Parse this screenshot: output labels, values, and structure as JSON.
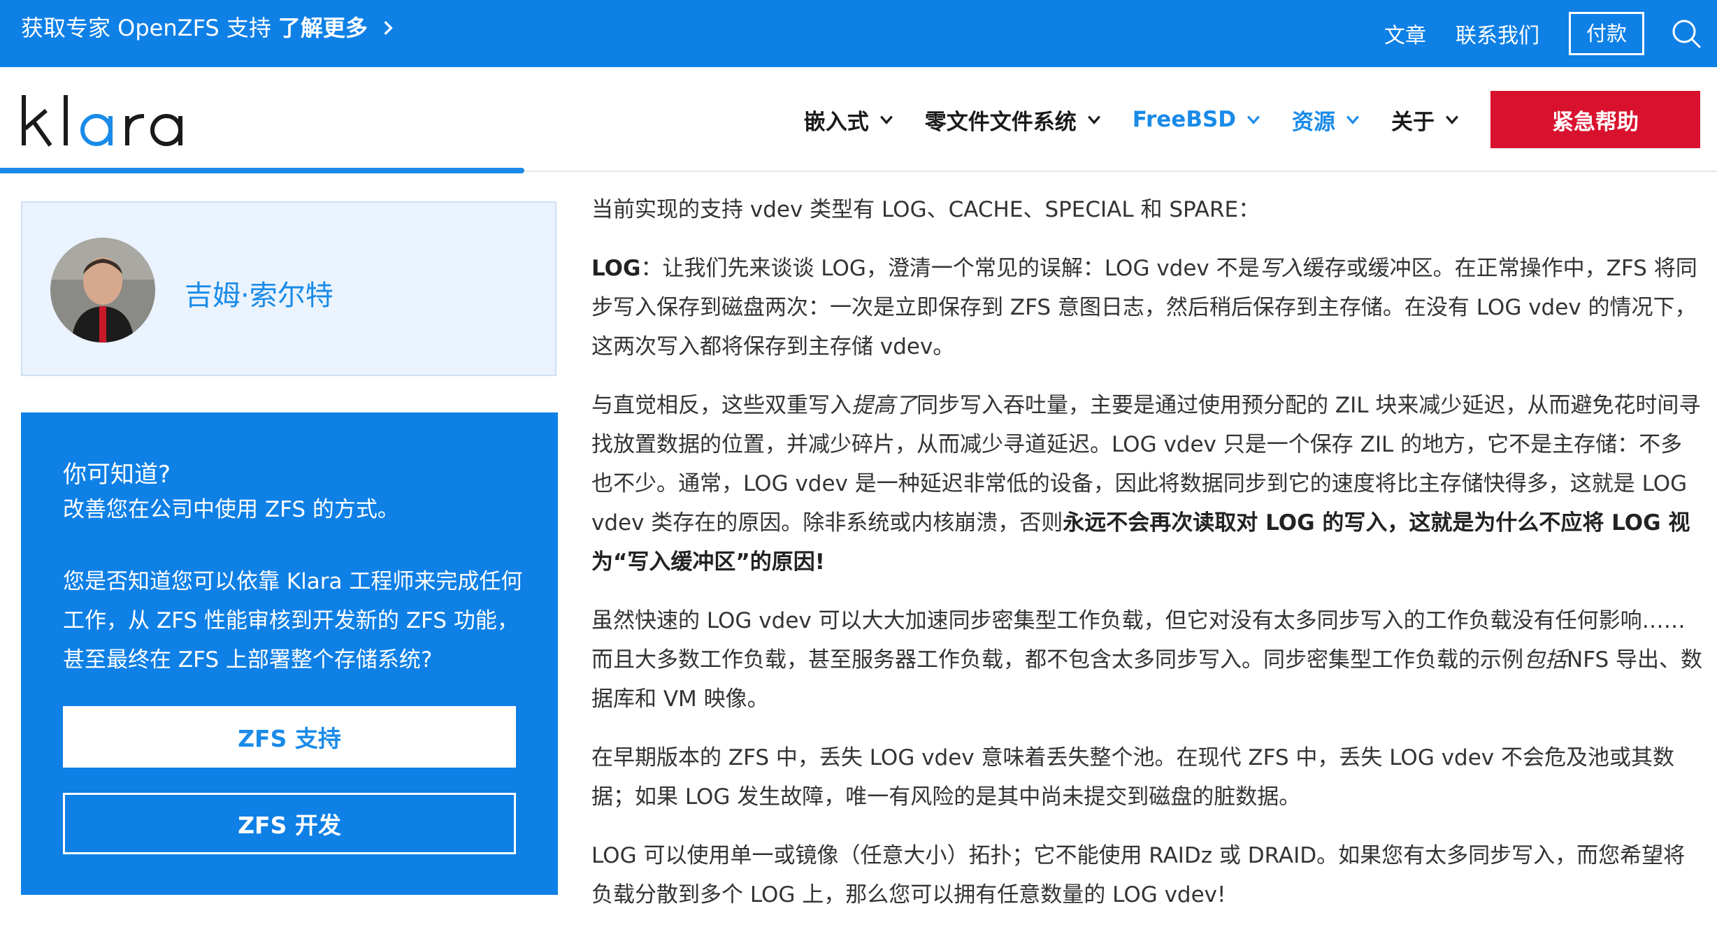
{
  "topbar": {
    "promo_prefix": "获取专家 OpenZFS 支持",
    "promo_strong": "了解更多",
    "links": [
      "文章",
      "联系我们"
    ],
    "pay": "付款"
  },
  "header": {
    "logo_text": "klara",
    "nav": [
      {
        "label": "嵌入式"
      },
      {
        "label": "零文件文件系统"
      },
      {
        "label": "FreeBSD"
      },
      {
        "label": "资源"
      },
      {
        "label": "关于"
      }
    ],
    "help": "紧急帮助"
  },
  "colors": {
    "brand_blue": "#0e80e6",
    "link_blue": "#1a8be8",
    "emergency_red": "#d8122e"
  },
  "author": {
    "name": "吉姆·索尔特"
  },
  "promo_card": {
    "title": "你可知道?",
    "subtitle": "改善您在公司中使用 ZFS 的方式。",
    "body": "您是否知道您可以依靠 Klara 工程师来完成任何工作，从 ZFS 性能审核到开发新的 ZFS 功能，甚至最终在 ZFS 上部署整个存储系统?",
    "btn_support": "ZFS 支持",
    "btn_dev": "ZFS 开发"
  },
  "article": {
    "p1": "当前实现的支持 vdev 类型有 LOG、CACHE、SPECIAL 和 SPARE：",
    "p2_bold": "LOG",
    "p2_a": "：让我们先来谈谈 LOG，澄清一个常见的误解：LOG vdev 不是",
    "p2_em": "写入",
    "p2_b": "缓存或缓冲区。在正常操作中，ZFS 将同步写入保存到磁盘两次：一次是立即保存到 ZFS 意图日志，然后稍后保存到主存储。在没有 LOG vdev 的情况下，这两次写入都将保存到主存储 vdev。",
    "p3_a": "与直觉相反，这些双重写入",
    "p3_em": "提高了",
    "p3_b": "同步写入吞吐量，主要是通过使用预分配的 ZIL 块来减少延迟，从而避免花时间寻找放置数据的位置，并减少碎片，从而减少寻道延迟。LOG vdev 只是一个保存 ZIL 的地方，它不是主存储：不多也不少。通常，LOG vdev 是一种延迟非常低的设备，因此将数据同步到它的速度将比主存储快得多，这就是 LOG vdev 类存在的原因。除非系统或内核崩溃，否则",
    "p3_bold": "永远不会再次读取对 LOG 的写入，这就是为什么不应将 LOG 视为“写入缓冲区”的原因!",
    "p4_a": "虽然快速的 LOG vdev 可以大大加速同步密集型工作负载，但它对没有太多同步写入的工作负载没有任何影响……而且大多数工作负载，甚至服务器工作负载，都不包含太多同步写入。同步密集型工作负载的示例",
    "p4_em": "包括",
    "p4_b": "NFS 导出、数据库和 VM 映像。",
    "p5": "在早期版本的 ZFS 中，丢失 LOG vdev 意味着丢失整个池。在现代 ZFS 中，丢失 LOG vdev 不会危及池或其数据；如果 LOG 发生故障，唯一有风险的是其中尚未提交到磁盘的脏数据。",
    "p6": "LOG 可以使用单一或镜像（任意大小）拓扑；它不能使用 RAIDz 或 DRAID。如果您有太多同步写入，而您希望将负载分散到多个 LOG 上，那么您可以拥有任意数量的 LOG vdev!"
  }
}
